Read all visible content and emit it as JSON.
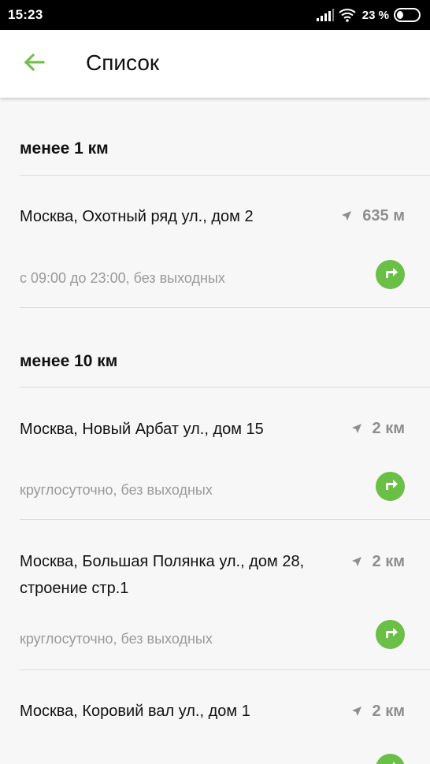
{
  "status_bar": {
    "time": "15:23",
    "battery": "23 %"
  },
  "app_bar": {
    "title": "Список",
    "accent_color": "#6abf45"
  },
  "sections": [
    {
      "header": "менее 1 км",
      "items": [
        {
          "title": "Москва, Охотный ряд ул., дом 2",
          "distance": "635 м",
          "hours": "с 09:00 до 23:00, без выходных"
        }
      ]
    },
    {
      "header": "менее 10 км",
      "items": [
        {
          "title": "Москва, Новый Арбат ул., дом 15",
          "distance": "2 км",
          "hours": "круглосуточно, без выходных"
        },
        {
          "title": "Москва, Большая Полянка ул., дом 28, строение стр.1",
          "distance": "2 км",
          "hours": "круглосуточно, без выходных"
        },
        {
          "title": "Москва, Коровий вал ул., дом 1",
          "distance": "2 км",
          "hours": ""
        }
      ]
    }
  ]
}
